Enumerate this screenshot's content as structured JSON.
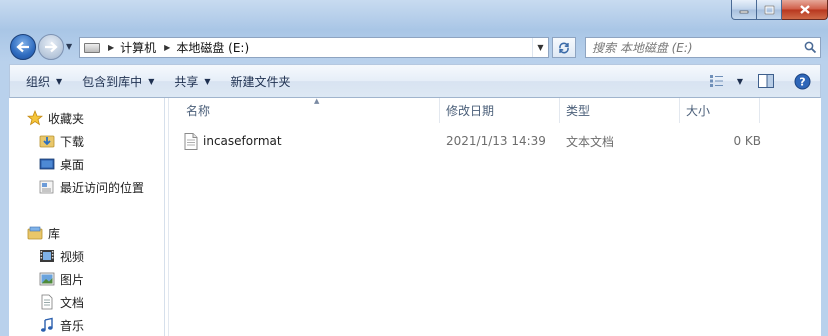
{
  "window": {
    "caption_buttons": [
      "minimize",
      "maximize",
      "close"
    ]
  },
  "address": {
    "crumbs": [
      "计算机",
      "本地磁盘 (E:)"
    ]
  },
  "search": {
    "placeholder": "搜索 本地磁盘 (E:)"
  },
  "toolbar": {
    "organize": "组织",
    "include_in_library": "包含到库中",
    "share": "共享",
    "new_folder": "新建文件夹"
  },
  "nav": {
    "favorites": {
      "label": "收藏夹",
      "items": [
        "下载",
        "桌面",
        "最近访问的位置"
      ]
    },
    "libraries": {
      "label": "库",
      "items": [
        "视频",
        "图片",
        "文档",
        "音乐"
      ]
    }
  },
  "columns": [
    "名称",
    "修改日期",
    "类型",
    "大小"
  ],
  "files": [
    {
      "name": "incaseformat",
      "modified": "2021/1/13 14:39",
      "type": "文本文档",
      "size": "0 KB"
    }
  ],
  "colors": {
    "frame_accent": "#a9c6e6",
    "column_header_text": "#4c607a",
    "date_text": "#6d6d6d"
  }
}
